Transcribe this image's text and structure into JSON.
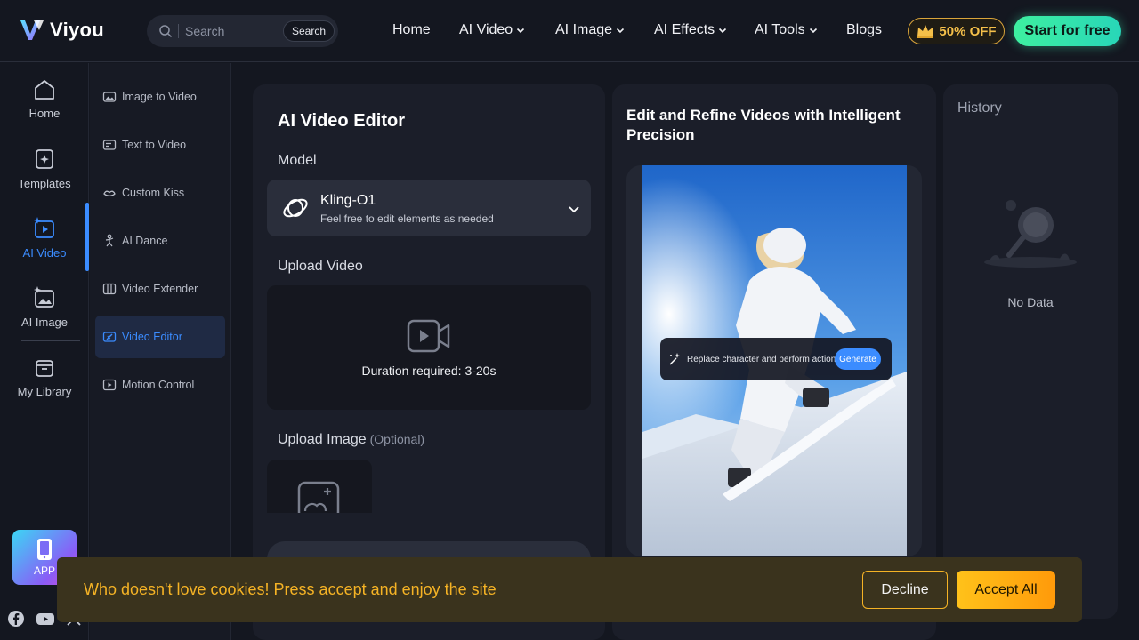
{
  "brand": {
    "name": "Viyou"
  },
  "header": {
    "search_placeholder": "Search",
    "search_button": "Search",
    "nav": [
      {
        "label": "Home"
      },
      {
        "label": "AI Video"
      },
      {
        "label": "AI Image"
      },
      {
        "label": "AI Effects"
      },
      {
        "label": "AI Tools"
      },
      {
        "label": "Blogs"
      }
    ],
    "promo": "50% OFF",
    "cta": "Start for free"
  },
  "rail": {
    "items": [
      {
        "label": "Home",
        "icon": "home-icon"
      },
      {
        "label": "Templates",
        "icon": "templates-icon"
      },
      {
        "label": "AI Video",
        "icon": "ai-video-icon",
        "active": true
      },
      {
        "label": "AI Image",
        "icon": "ai-image-icon"
      },
      {
        "label": "My Library",
        "icon": "library-icon"
      }
    ],
    "app_label": "APP"
  },
  "submenu": {
    "items": [
      {
        "label": "Image to Video"
      },
      {
        "label": "Text to Video"
      },
      {
        "label": "Custom Kiss"
      },
      {
        "label": "AI Dance"
      },
      {
        "label": "Video Extender"
      },
      {
        "label": "Video Editor",
        "active": true
      },
      {
        "label": "Motion Control"
      }
    ]
  },
  "editor": {
    "title": "AI Video Editor",
    "model_label": "Model",
    "model_name": "Kling-O1",
    "model_desc": "Feel free to edit elements as needed",
    "upload_video_label": "Upload Video",
    "duration_text": "Duration required: 3-20s",
    "upload_image_label": "Upload Image",
    "upload_image_optional": "(Optional)"
  },
  "preview": {
    "title": "Edit and Refine Videos with Intelligent Precision",
    "prompt_text": "Replace character and perform action",
    "generate_label": "Generate"
  },
  "history": {
    "title": "History",
    "empty_text": "No Data"
  },
  "cookie": {
    "message": "Who doesn't love cookies! Press accept and enjoy the site",
    "decline": "Decline",
    "accept": "Accept All"
  },
  "colors": {
    "accent": "#3b8cff",
    "cta_green": "#3ef0a0",
    "promo_gold": "#f5c04a",
    "cookie_text": "#f5b325"
  }
}
